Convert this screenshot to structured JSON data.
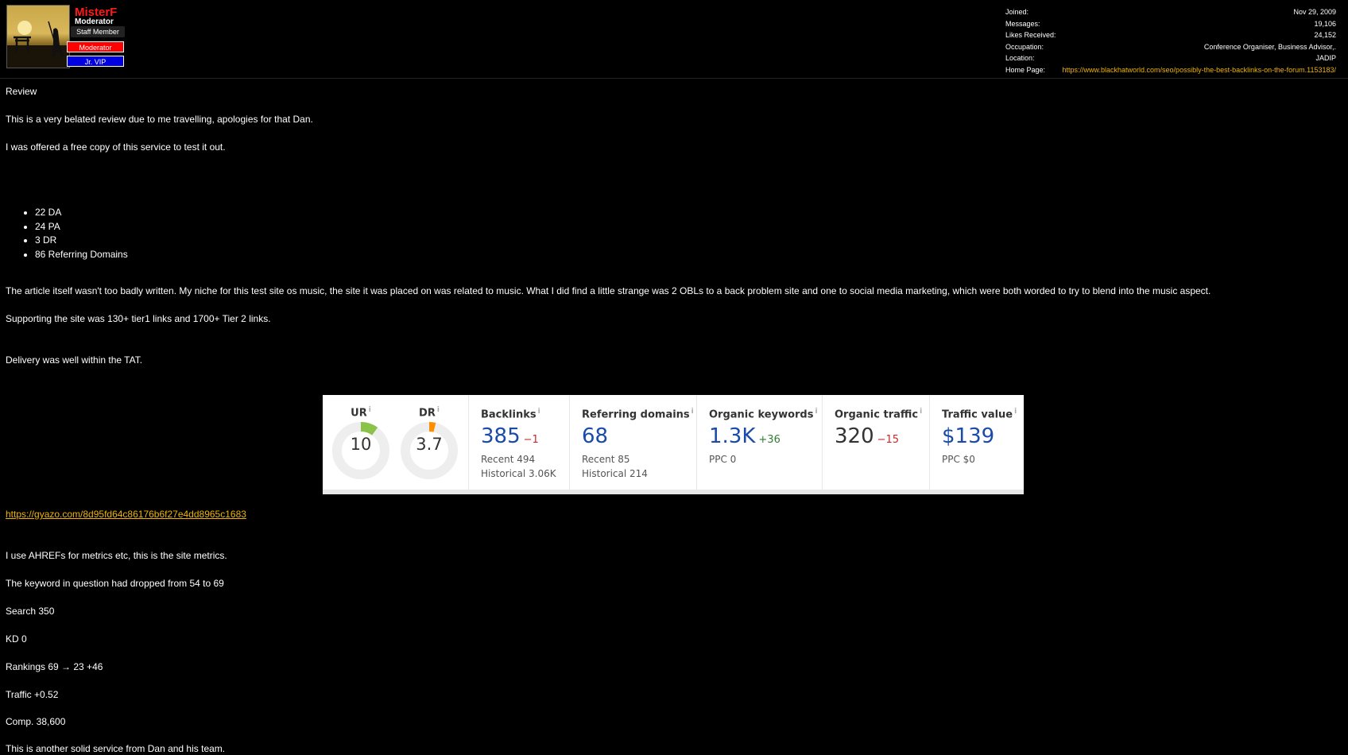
{
  "user": {
    "name": "MisterF",
    "title": "Moderator",
    "staff_badge": "Staff Member",
    "badges": [
      "Moderator",
      "Jr. VIP"
    ]
  },
  "stats": [
    {
      "label": "Joined:",
      "value": "Nov 29, 2009"
    },
    {
      "label": "Messages:",
      "value": "19,106"
    },
    {
      "label": "Likes Received:",
      "value": "24,152"
    },
    {
      "label": "Occupation:",
      "value": "Conference Organiser, Business Advisor,."
    },
    {
      "label": "Location:",
      "value": "JADIP"
    },
    {
      "label": "Home Page:",
      "value": "https://www.blackhatworld.com/seo/possibly-the-best-backlinks-on-the-forum.1153183/"
    }
  ],
  "post": {
    "heading": "Review",
    "p1": "This is a very belated review due to me travelling, apologies for that Dan.",
    "p2": "I was offered a free copy of this service to test it out.",
    "bullets": [
      "22 DA",
      "24 PA",
      "3 DR",
      "86 Referring Domains"
    ],
    "p3": "The article itself wasn't too badly written. My niche for this test site os music, the site it was placed on was related to music. What I did find a little strange was 2 OBLs to a back problem site and one to social media marketing, which were both worded to try to blend into the music aspect.",
    "p4": "Supporting the site was 130+ tier1 links and 1700+ Tier 2 links.",
    "p5": "Delivery was well within the TAT.",
    "link": "https://gyazo.com/8d95fd64c86176b6f27e4dd8965c1683",
    "p6": "I use AHREFs for metrics etc, this is the site metrics.",
    "p7": "The keyword in question had dropped from 54 to 69",
    "p8": "Search 350",
    "p9": "KD 0",
    "p10": "Rankings 69 → 23 +46",
    "p11": "Traffic +0.52",
    "p12": "Comp. 38,600",
    "p13": "This is another solid service from Dan and his team."
  },
  "metrics": {
    "ur": {
      "label": "UR",
      "value": "10",
      "score": 10,
      "color": "#8bc34a"
    },
    "dr": {
      "label": "DR",
      "value": "3.7",
      "score": 3.7,
      "color": "#ff8f00"
    },
    "backlinks": {
      "label": "Backlinks",
      "value": "385",
      "delta": "−1",
      "recent": "Recent 494",
      "historical": "Historical 3.06K"
    },
    "referring_domains": {
      "label": "Referring domains",
      "value": "68",
      "recent": "Recent 85",
      "historical": "Historical 214"
    },
    "organic_keywords": {
      "label": "Organic keywords",
      "value": "1.3K",
      "delta": "+36",
      "ppc": "PPC 0"
    },
    "organic_traffic": {
      "label": "Organic traffic",
      "value": "320",
      "delta": "−15"
    },
    "traffic_value": {
      "label": "Traffic value",
      "value": "$139",
      "ppc": "PPC $0"
    },
    "info_glyph": "i"
  }
}
